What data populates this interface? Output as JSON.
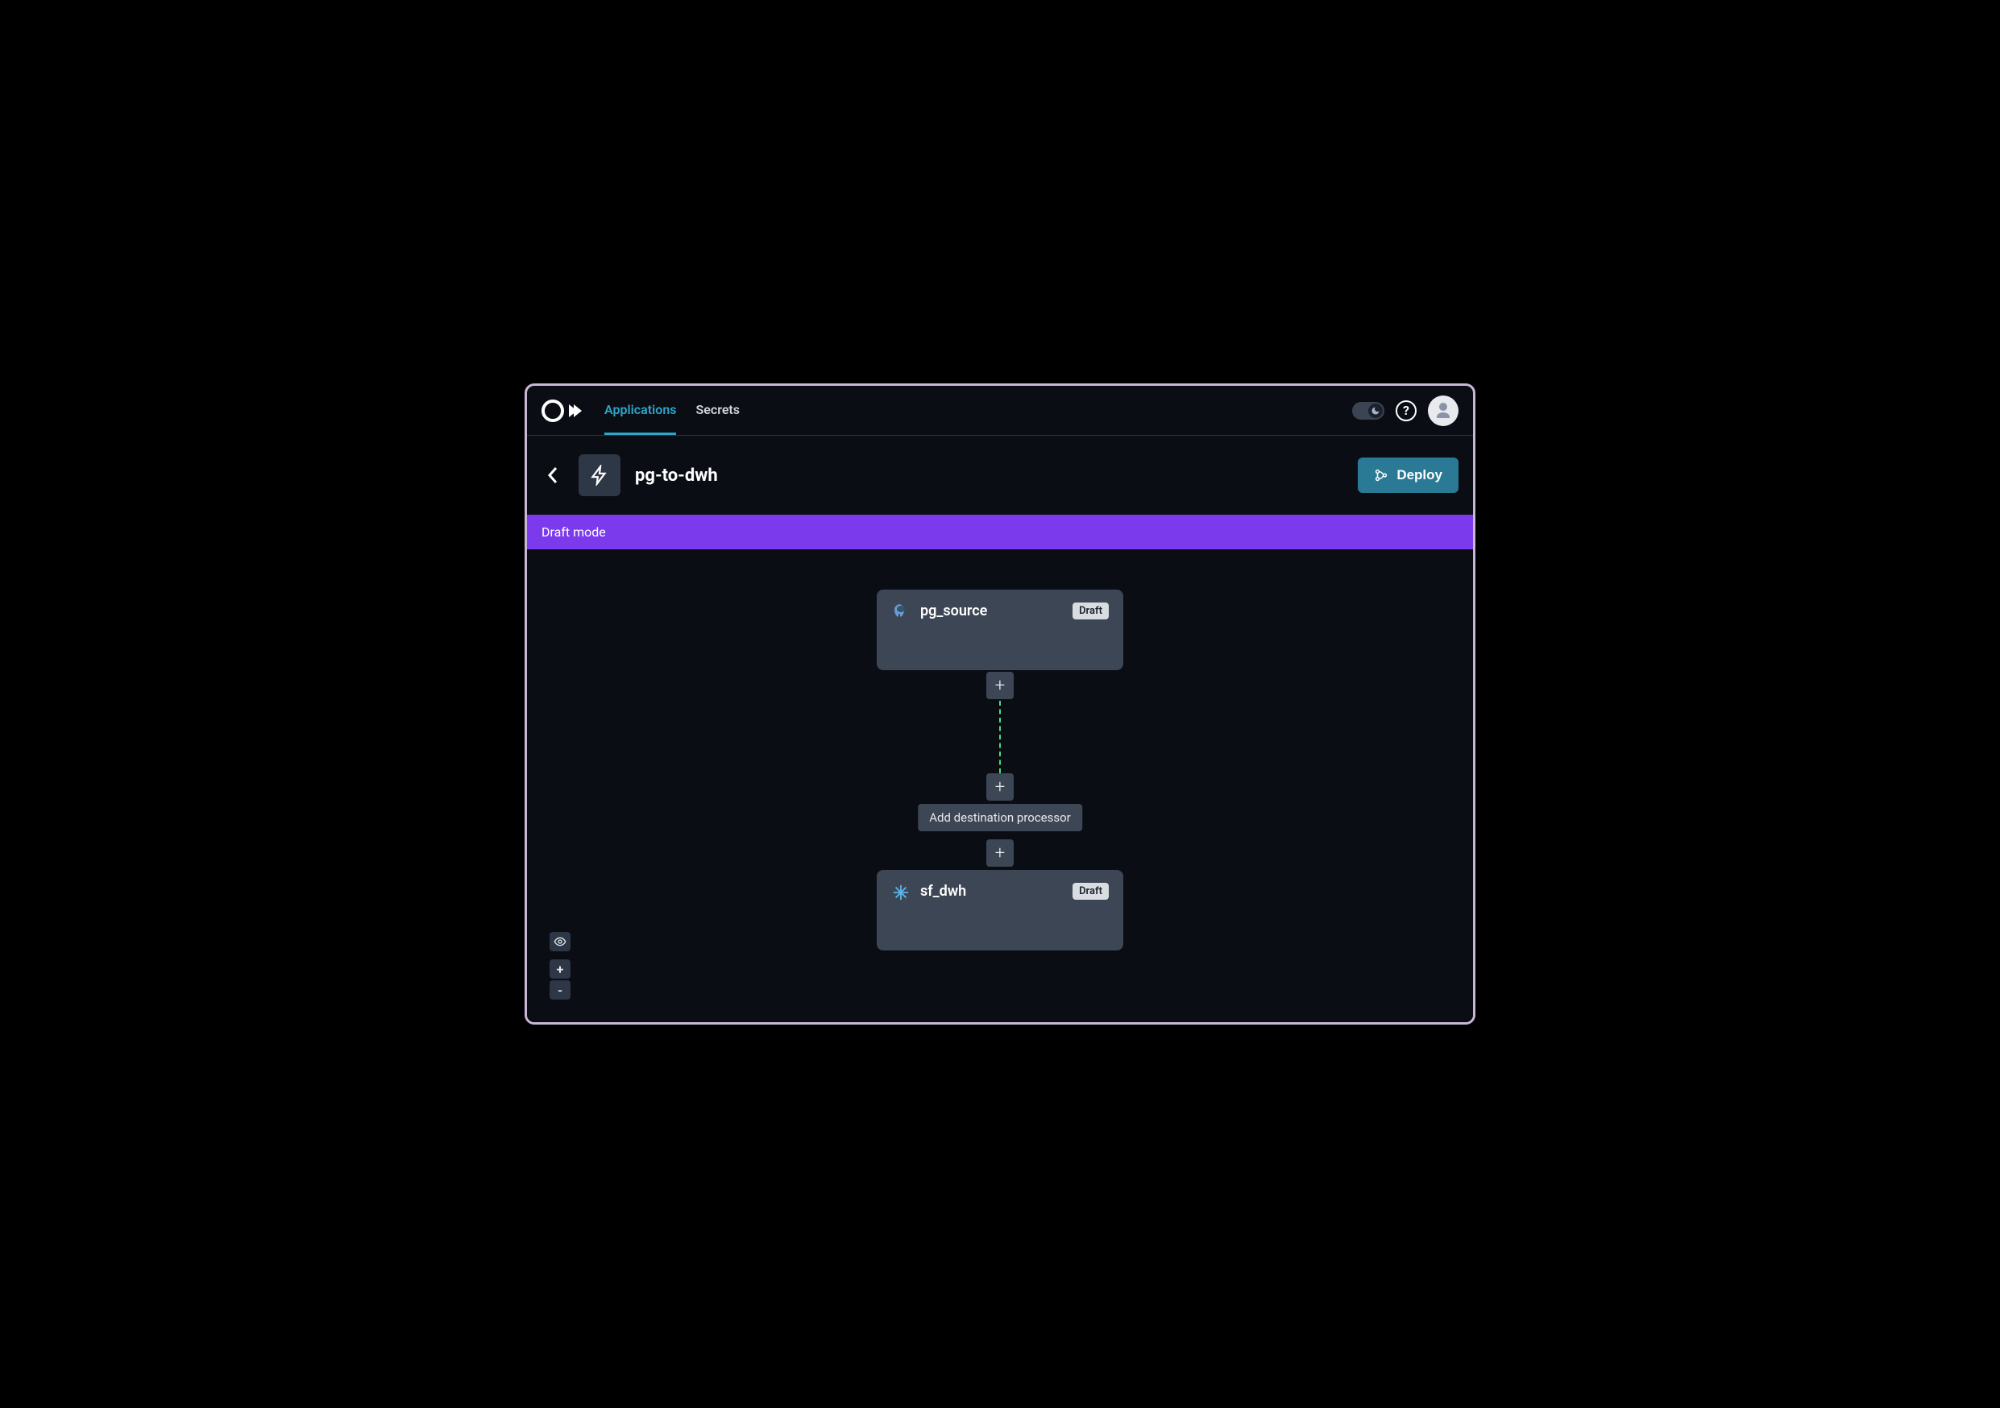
{
  "nav": {
    "tabs": [
      {
        "label": "Applications",
        "active": true
      },
      {
        "label": "Secrets",
        "active": false
      }
    ]
  },
  "app": {
    "title": "pg-to-dwh",
    "deploy_label": "Deploy"
  },
  "banner": {
    "text": "Draft mode"
  },
  "flow": {
    "nodes": [
      {
        "label": "pg_source",
        "badge": "Draft",
        "icon": "postgres"
      },
      {
        "label": "sf_dwh",
        "badge": "Draft",
        "icon": "snowflake"
      }
    ],
    "tooltip": "Add destination processor"
  },
  "controls": {
    "zoom_in": "+",
    "zoom_out": "-"
  }
}
